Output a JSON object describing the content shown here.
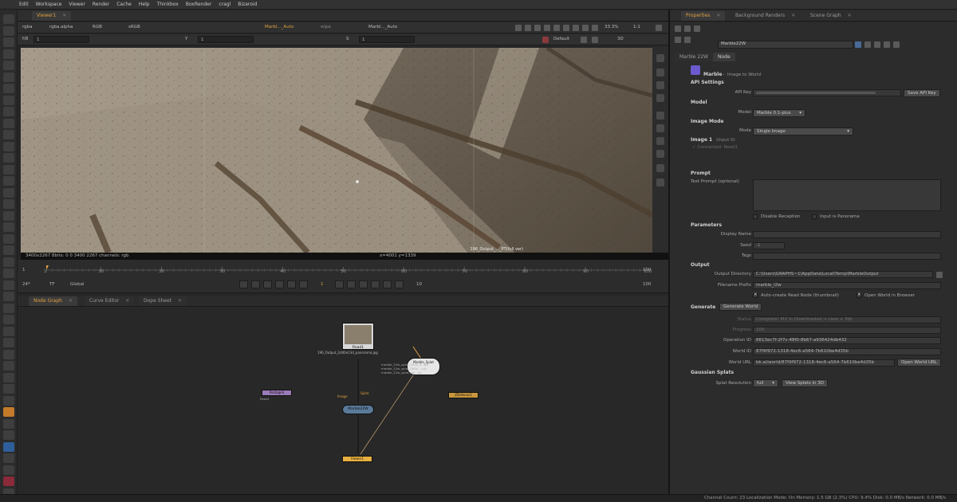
{
  "menu": [
    "Edit",
    "Workspace",
    "Viewer",
    "Render",
    "Cache",
    "Help",
    "Thinkbox",
    "BoxRender",
    "cragl",
    "Bizaroid"
  ],
  "viewer": {
    "tab": "Viewer1",
    "channels": "rgba",
    "alpha": "rgba.alpha",
    "colorspace": "RGB",
    "srgb": "sRGB",
    "input_a": "Marbl..._Auto",
    "wipe": "wipe",
    "input_b": "Marbl..._Auto",
    "zoom": "33.3%",
    "ratio": "1:1",
    "gain_label": "f/8",
    "gain_value": "1",
    "gamma_label": "Y",
    "gamma_value": "1",
    "frame_label": "S",
    "frame_value": "1",
    "view_mode": "Default",
    "view3d": "3D",
    "image_label": "196_Output_..._PT(full ver)",
    "info_left": "3400x2267 8bits: 0 0 3400 2267 channels: rgb",
    "info_coords": "x=4001 y=1339"
  },
  "timeline": {
    "ticks": [
      "1",
      "10",
      "20",
      "30",
      "40",
      "50",
      "60",
      "70",
      "80",
      "90",
      "100"
    ],
    "start": "1",
    "end": "100",
    "fps": "24*",
    "tf": "TF",
    "scope": "Global",
    "frame": "1",
    "step": "10",
    "range_end": "100"
  },
  "node_tabs": [
    "Node Graph",
    "Curve Editor",
    "Dope Sheet"
  ],
  "nodes": {
    "read": "Read1",
    "read_sub": "196_Output_2d40e13d_panorama.jpg",
    "marble_top": "Marble_Splat",
    "marble_lines": [
      "marble_22w_splat_100k_d...ply",
      "marble_22w_splat_500k_...ply",
      "marble_22w_splat_full...ply"
    ],
    "marble_node": "Marble22W",
    "viewer_node": "Viewer1",
    "purple": "PostageS",
    "purple_sub": "Read1",
    "orange": "ZDefocus1",
    "pipe_a": "Image",
    "pipe_b": "Splat"
  },
  "props_tabs": [
    "Properties",
    "Background Renders",
    "Scene Graph"
  ],
  "props": {
    "node_name": "Marble22W",
    "subtab1": "Marble 22W",
    "subtab2": "Node",
    "title": "Marble",
    "subtitle": "Image to World",
    "api_settings": "API Settings",
    "api_key_label": "API Key",
    "save_api_key": "Save API Key",
    "model_section": "Model",
    "model_label": "Model",
    "model_value": "Marble 0.1-plus",
    "image_mode_section": "Image Mode",
    "mode_label": "Mode",
    "mode_value": "Single Image",
    "image1_label": "Image 1",
    "image1_input": "(Input 0)",
    "image1_connected": "✓ Connected: Read1",
    "prompt_section": "Prompt",
    "text_prompt_label": "Text Prompt (optional)",
    "disable_recaption": "Disable Recaption",
    "input_panorama": "Input is Panorama",
    "parameters_section": "Parameters",
    "display_name_label": "Display Name",
    "seed_label": "Seed",
    "seed_value": "-1",
    "tags_label": "Tags",
    "output_section": "Output",
    "output_dir_label": "Output Directory",
    "output_dir_value": "C:\\Users\\GRAPHS~1\\AppData\\Local\\Temp\\MarbleOutput",
    "filename_prefix_label": "Filename Prefix",
    "filename_prefix_value": "marble_l2w",
    "auto_read": "Auto-create Read Node (thumbnail)",
    "open_browser": "Open World in Browser",
    "generate_section": "Generate",
    "generate_button": "Generate World",
    "status_label": "Status",
    "status_value": "Complete! PLY in Downloaded → view + 3ds",
    "progress_label": "Progress",
    "progress_value": "100",
    "operation_id_label": "Operation ID",
    "operation_id_value": "6613ec7f-2f7c-48f0-8b67-a936424db432",
    "world_id_label": "World ID",
    "world_id_value": "87f9f972-1318-4ec6-a564-7b610be4d35b",
    "world_url_label": "World URL",
    "world_url_value": "bk.ai/world/87f9f972-1318-4ec6-a564-7b610be4d35b",
    "open_world_url": "Open World URL",
    "gaussian_section": "Gaussian Splats",
    "splat_res_label": "Splat Resolution",
    "splat_res_value": "full",
    "view_splats_button": "View Splats in 3D"
  },
  "status": "Channel Count: 23  Localization Mode: On  Memory: 1.5 GB (2.3%)  CPU: 9.4%  Disk: 0.0 MB/s  Network: 0.0 MB/s"
}
